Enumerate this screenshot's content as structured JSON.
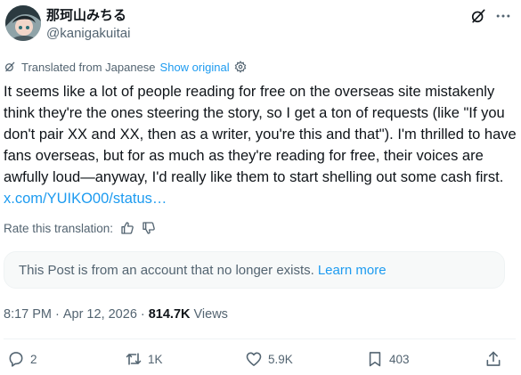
{
  "author": {
    "display_name": "那珂山みちる",
    "handle": "@kanigakuitai"
  },
  "translation": {
    "label": "Translated from Japanese",
    "show_original": "Show original",
    "rate_label": "Rate this translation:"
  },
  "post": {
    "text": "It seems like a lot of people reading for free on the overseas site mistakenly think they're the ones steering the story, so I get a ton of requests (like \"If you don't pair XX and XX, then as a writer, you're this and that\"). I'm thrilled to have fans overseas, but for as much as they're reading for free, their voices are awfully loud—anyway, I'd really like them to start shelling out some cash first.",
    "link": "x.com/YUIKO00/status…"
  },
  "notice": {
    "text": "This Post is from an account that no longer exists.",
    "learn_more": "Learn more"
  },
  "meta": {
    "time": "8:17 PM",
    "separator": "·",
    "date": "Apr 12, 2026",
    "views_count": "814.7K",
    "views_label": "Views"
  },
  "actions": {
    "replies": "2",
    "reposts": "1K",
    "likes": "5.9K",
    "bookmarks": "403"
  },
  "icons": {
    "grok": "grok-icon",
    "more": "more-icon",
    "translate": "translate-icon",
    "gear": "gear-icon",
    "thumbs_up": "thumbs-up-icon",
    "thumbs_down": "thumbs-down-icon",
    "reply": "reply-icon",
    "repost": "repost-icon",
    "like": "heart-icon",
    "bookmark": "bookmark-icon",
    "share": "share-icon"
  },
  "colors": {
    "link": "#1d9bf0",
    "text": "#0f1419",
    "secondary": "#536471",
    "notice_bg": "#f7f9f9"
  }
}
